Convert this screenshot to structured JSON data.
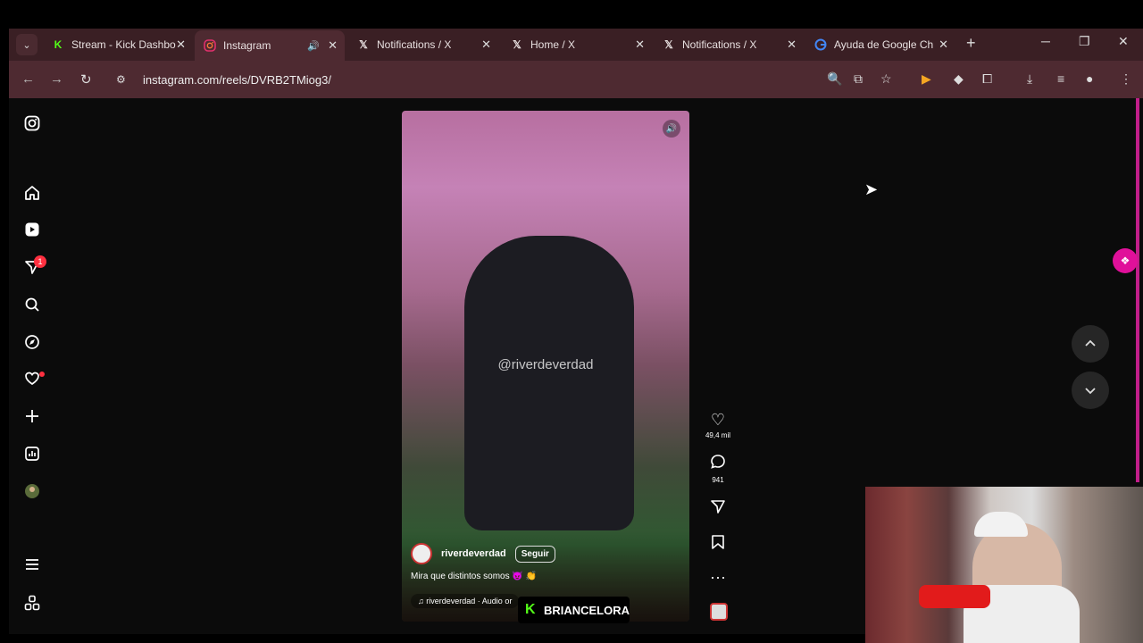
{
  "browser": {
    "tabs": [
      {
        "icon": "kick-favicon",
        "title": "Stream - Kick Dashbo",
        "active": false,
        "color": "#53fc18"
      },
      {
        "icon": "instagram-favicon",
        "title": "Instagram",
        "active": true,
        "playing_audio": true
      },
      {
        "icon": "x-favicon",
        "title": "Notifications / X",
        "active": false
      },
      {
        "icon": "x-favicon",
        "title": "Home / X",
        "active": false
      },
      {
        "icon": "x-favicon",
        "title": "Notifications / X",
        "active": false
      },
      {
        "icon": "google-favicon",
        "title": "Ayuda de Google Ch",
        "active": false
      }
    ],
    "url": "instagram.com/reels/DVRB2TMiog3/",
    "tabstrip_color": "#3a1f24",
    "toolbar_color": "#4e2a31"
  },
  "sidebar": {
    "items": [
      {
        "name": "instagram-logo-icon"
      },
      {
        "name": "home-icon"
      },
      {
        "name": "reels-icon"
      },
      {
        "name": "messages-icon",
        "badge": "1"
      },
      {
        "name": "search-icon"
      },
      {
        "name": "explore-icon"
      },
      {
        "name": "notifications-icon",
        "dot": true
      },
      {
        "name": "create-icon"
      },
      {
        "name": "dashboard-icon"
      },
      {
        "name": "profile-avatar"
      },
      {
        "name": "more-menu-icon"
      },
      {
        "name": "also-from-meta-icon"
      }
    ]
  },
  "reel": {
    "watermark": "@riverdeverdad",
    "author": "riverdeverdad",
    "follow_label": "Seguir",
    "caption": "Mira que distintos somos 😈 👏",
    "audio": "riverdeverdad · Audio or",
    "likes": "49,4 mil",
    "comments": "941"
  },
  "overlay": {
    "kick_name": "BRIANCELORA",
    "kick_color": "#53fc18"
  },
  "accent": "#e0109a"
}
